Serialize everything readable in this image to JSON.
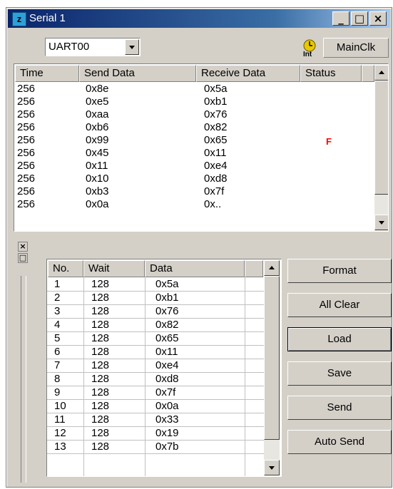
{
  "window": {
    "title": "Serial 1",
    "app_icon": "z"
  },
  "titlebar_buttons": [
    "_",
    "□",
    "×"
  ],
  "toolbar": {
    "port": "UART00",
    "clock_label": "Int",
    "clock_button": "MainClk"
  },
  "log": {
    "columns": [
      "Time",
      "Send Data",
      "Receive Data",
      "Status"
    ],
    "rows": [
      {
        "time": "256",
        "send": "0x8e",
        "receive": "0x5a",
        "status": ""
      },
      {
        "time": "256",
        "send": "0xe5",
        "receive": "0xb1",
        "status": ""
      },
      {
        "time": "256",
        "send": "0xaa",
        "receive": "0x76",
        "status": ""
      },
      {
        "time": "256",
        "send": "0xb6",
        "receive": "0x82",
        "status": ""
      },
      {
        "time": "256",
        "send": "0x99",
        "receive": "0x65",
        "status": "F"
      },
      {
        "time": "256",
        "send": "0x45",
        "receive": "0x11",
        "status": ""
      },
      {
        "time": "256",
        "send": "0x11",
        "receive": "0xe4",
        "status": ""
      },
      {
        "time": "256",
        "send": "0x10",
        "receive": "0xd8",
        "status": ""
      },
      {
        "time": "256",
        "send": "0xb3",
        "receive": "0x7f",
        "status": ""
      },
      {
        "time": "256",
        "send": "0x0a",
        "receive": "0x..",
        "status": ""
      }
    ]
  },
  "mini_buttons": [
    "×",
    "□"
  ],
  "table": {
    "columns": [
      "No.",
      "Wait",
      "Data"
    ],
    "rows": [
      {
        "no": "1",
        "wait": "128",
        "data": "0x5a"
      },
      {
        "no": "2",
        "wait": "128",
        "data": "0xb1"
      },
      {
        "no": "3",
        "wait": "128",
        "data": "0x76"
      },
      {
        "no": "4",
        "wait": "128",
        "data": "0x82"
      },
      {
        "no": "5",
        "wait": "128",
        "data": "0x65"
      },
      {
        "no": "6",
        "wait": "128",
        "data": "0x11"
      },
      {
        "no": "7",
        "wait": "128",
        "data": "0xe4"
      },
      {
        "no": "8",
        "wait": "128",
        "data": "0xd8"
      },
      {
        "no": "9",
        "wait": "128",
        "data": "0x7f"
      },
      {
        "no": "10",
        "wait": "128",
        "data": "0x0a"
      },
      {
        "no": "11",
        "wait": "128",
        "data": "0x33"
      },
      {
        "no": "12",
        "wait": "128",
        "data": "0x19"
      },
      {
        "no": "13",
        "wait": "128",
        "data": "0x7b"
      }
    ]
  },
  "buttons": {
    "format": "Format",
    "all_clear": "All Clear",
    "load": "Load",
    "save": "Save",
    "send": "Send",
    "auto_send": "Auto Send"
  },
  "colors": {
    "title_start": "#0a246a",
    "title_end": "#a6caf0",
    "face": "#d4d0c8",
    "status_error": "#ff0000",
    "clock_icon": "#e8c800"
  },
  "icons": [
    "app-z-icon",
    "minimize-icon",
    "maximize-icon",
    "close-icon",
    "clock-icon",
    "dropdown-arrow-icon",
    "scroll-up-icon",
    "scroll-down-icon"
  ]
}
